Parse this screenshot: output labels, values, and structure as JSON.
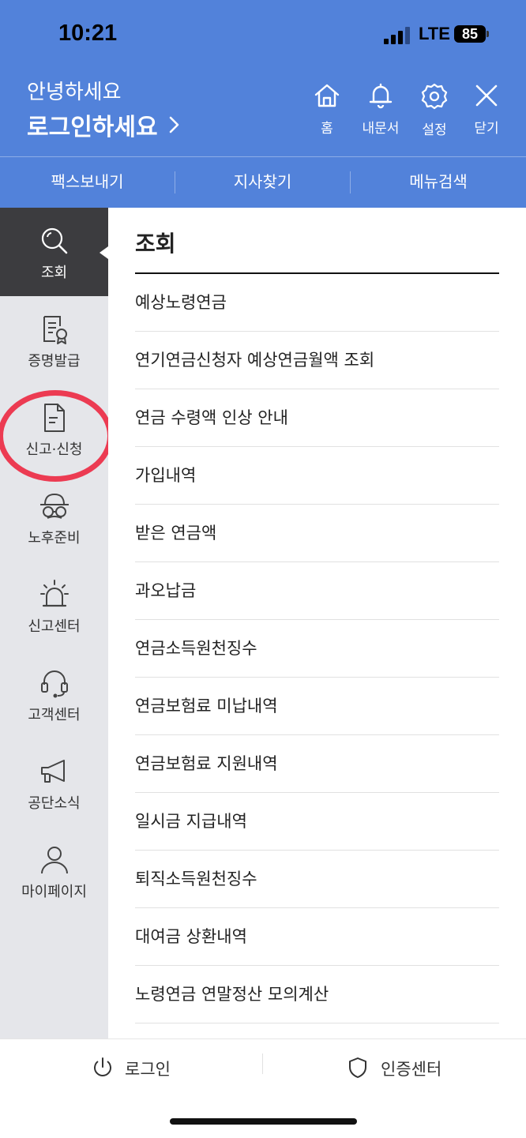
{
  "status_bar": {
    "time": "10:21",
    "network": "LTE",
    "battery": "85"
  },
  "header": {
    "greeting": "안녕하세요",
    "login_prompt": "로그인하세요",
    "icons": [
      {
        "name": "home-icon",
        "label": "홈"
      },
      {
        "name": "bell-icon",
        "label": "내문서"
      },
      {
        "name": "gear-icon",
        "label": "설정"
      },
      {
        "name": "close-icon",
        "label": "닫기"
      }
    ]
  },
  "quick_links": [
    "팩스보내기",
    "지사찾기",
    "메뉴검색"
  ],
  "sidebar": {
    "items": [
      {
        "icon": "search-icon",
        "label": "조회",
        "active": true
      },
      {
        "icon": "certificate-icon",
        "label": "증명발급"
      },
      {
        "icon": "document-icon",
        "label": "신고·신청"
      },
      {
        "icon": "glasses-hat-icon",
        "label": "노후준비"
      },
      {
        "icon": "siren-icon",
        "label": "신고센터"
      },
      {
        "icon": "headset-icon",
        "label": "고객센터"
      },
      {
        "icon": "megaphone-icon",
        "label": "공단소식"
      },
      {
        "icon": "person-icon",
        "label": "마이페이지"
      }
    ],
    "highlight_color": "#EC3B52"
  },
  "main": {
    "title": "조회",
    "items": [
      "예상노령연금",
      "연기연금신청자 예상연금월액 조회",
      "연금 수령액 인상 안내",
      "가입내역",
      "받은 연금액",
      "과오납금",
      "연금소득원천징수",
      "연금보험료 미납내역",
      "연금보험료 지원내역",
      "일시금 지급내역",
      "퇴직소득원천징수",
      "대여금 상환내역",
      "노령연금 연말정산 모의계산"
    ]
  },
  "footer": {
    "login": "로그인",
    "auth_center": "인증센터"
  },
  "colors": {
    "header_bg": "#5282DA",
    "sidebar_bg": "#E5E6EA",
    "sidebar_active": "#3C3C3F"
  }
}
